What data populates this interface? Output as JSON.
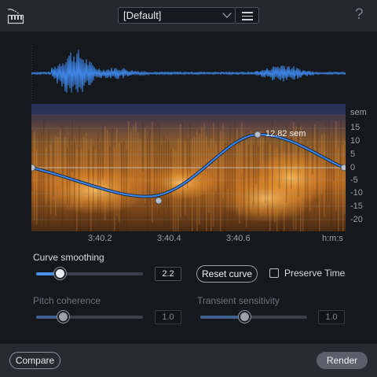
{
  "header": {
    "preset_value": "[Default]",
    "help_label": "?",
    "icons": [
      "keyboard-piano-icon",
      "chevron-down-icon",
      "hamburger-menu-icon",
      "help-icon"
    ]
  },
  "display": {
    "pitch_axis_unit": "sem",
    "pitch_ticks": [
      "15",
      "10",
      "5",
      "0",
      "-5",
      "-10",
      "-15",
      "-20"
    ],
    "time_unit": "h:m:s",
    "time_ticks": [
      "3:40.2",
      "3:40.4",
      "3:40.6"
    ],
    "curve_tooltip": "12.82 sem",
    "colors": {
      "curve": "#3e86e8",
      "waveform": "#3e86e8",
      "spectrogram_hot": "#f0a030"
    }
  },
  "controls": {
    "curve_smoothing_label": "Curve smoothing",
    "curve_smoothing_value": "2.2",
    "curve_smoothing_level": 0.22,
    "reset_curve_label": "Reset curve",
    "preserve_time_label": "Preserve Time",
    "preserve_time_checked": false,
    "pitch_coherence_label": "Pitch coherence",
    "pitch_coherence_value": "1.0",
    "pitch_coherence_level": 0.25,
    "transient_sensitivity_label": "Transient sensitivity",
    "transient_sensitivity_value": "1.0",
    "transient_sensitivity_level": 0.41
  },
  "footer": {
    "compare_label": "Compare",
    "render_label": "Render"
  }
}
